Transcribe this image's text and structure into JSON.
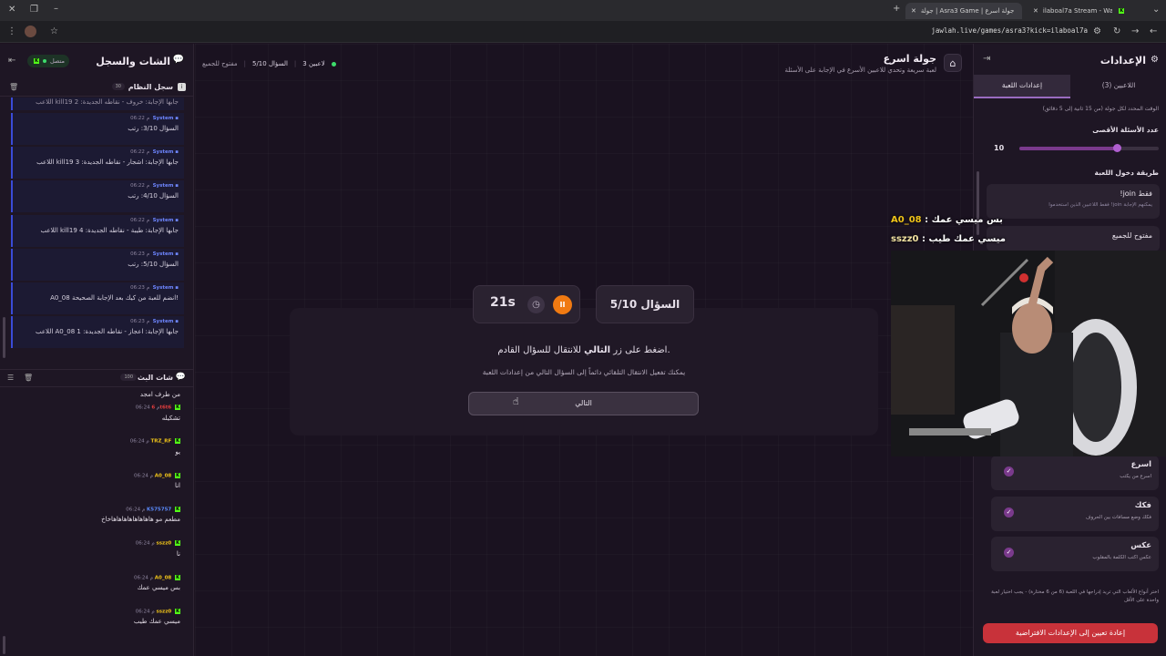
{
  "browser": {
    "tabs": [
      {
        "title": "جولة | Asra3 Game | جولة اسرع",
        "active": true
      },
      {
        "title": "ilaboal7a Stream - Watch Live o",
        "active": false
      }
    ],
    "url": "jawlah.live/games/asra3?kick=ilaboal7a"
  },
  "left_panel": {
    "title": "الشات والسجل",
    "connected_label": "متصل",
    "system_log": {
      "title": "سجل النظام",
      "count": "30",
      "cut_message": "اللاعب kill19 جابها الإجابة: خروف - نقاطه الجديدة: 2",
      "messages": [
        {
          "sender": "System",
          "time": "06:22 م",
          "text": "السؤال 3/10: رتب"
        },
        {
          "sender": "System",
          "time": "06:22 م",
          "text": "اللاعب kill19 جابها الإجابة: اشجار - نقاطه الجديدة: 3"
        },
        {
          "sender": "System",
          "time": "06:22 م",
          "text": "السؤال 4/10: رتب"
        },
        {
          "sender": "System",
          "time": "06:22 م",
          "text": "اللاعب kill19 جابها الإجابة: طيبة - نقاطه الجديدة: 4"
        },
        {
          "sender": "System",
          "time": "06:23 م",
          "text": "السؤال 5/10: رتب"
        },
        {
          "sender": "System",
          "time": "06:23 م",
          "text": "A0_08 انضم للعبة من كيك بعد الإجابة الصحيحة!"
        },
        {
          "sender": "System",
          "time": "06:23 م",
          "text": "اللاعب A0_08 جابها الإجابة: اعجاز - نقاطه الجديدة: 1"
        }
      ]
    },
    "live_chat": {
      "title": "شات البث",
      "count": "100",
      "cut_message": "من طرف امجد",
      "messages": [
        {
          "user": "6t6t6",
          "color": "#e23d3d",
          "time": "06:24 م",
          "text": "تشكيله"
        },
        {
          "user": "TRZ_RF",
          "color": "#f0c419",
          "time": "06:24 م",
          "text": "يو"
        },
        {
          "user": "A0_08",
          "color": "#f0c419",
          "time": "06:24 م",
          "text": "انا"
        },
        {
          "user": "K575757",
          "color": "#5b8cff",
          "time": "06:24 م",
          "text": "مطعم مو هاهاهاهاهاهاهاهاخاخ"
        },
        {
          "user": "sszz0",
          "color": "#f0c419",
          "time": "06:24 م",
          "text": "نا"
        },
        {
          "user": "A0_08",
          "color": "#f0c419",
          "time": "06:24 م",
          "text": "بس ميسي عمك"
        },
        {
          "user": "sszz0",
          "color": "#f0c419",
          "time": "06:24 م",
          "text": "ميسي عمك طيب"
        }
      ]
    }
  },
  "center": {
    "title": "جولة اسرع",
    "subtitle": "لعبة سريعة وتحدي للاعبين الأسرع في الإجابة على الأسئلة",
    "players": "3 لاعبين",
    "question_progress": "السؤال 5/10",
    "mode": "مفتوح للجميع",
    "question_label": "السؤال 5/10",
    "timer": "21s",
    "instruction_pre": "اضغط على زر ",
    "instruction_bold": "التالي",
    "instruction_post": " للانتقال للسؤال القادم.",
    "hint": "يمكنك تفعيل الانتقال التلقائي دائماً إلى السؤال التالي من إعدادات اللعبة",
    "next_button": "التالي"
  },
  "right_panel": {
    "title": "الإعدادات",
    "tabs": [
      "إعدادات اللعبة",
      "اللاعبين (3)"
    ],
    "time_note": "الوقت المحدد لكل جولة (من 15 ثانية إلى 5 دقائق)",
    "max_questions_label": "عدد الأسئلة الأقصى",
    "max_questions_value": "10",
    "max_questions_fraction": 0.7,
    "join_method_label": "طريقة دخول اللعبة",
    "join_options": [
      {
        "title": "!join فقط",
        "desc": "فقط اللاعبين الذين استخدموا !join يمكنهم الإجابة"
      },
      {
        "title": "مفتوح للجميع",
        "desc": ""
      }
    ],
    "game_types": [
      {
        "title": "اسرع",
        "desc": "اسرع من يكتب"
      },
      {
        "title": "فكك",
        "desc": "فكك وضع مسافات بين الحروف"
      },
      {
        "title": "عكس",
        "desc": "عكس اكتب الكلمة بالمقلوب"
      }
    ],
    "types_note": "اختر أنواع الألعاب التي تريد إدراجها في اللعبة (6 من 6 مختارة) - يجب اختيار لعبة واحدة على الأقل",
    "reset_button": "إعادة تعيين إلى الإعدادات الافتراضية"
  },
  "overlay": {
    "chat_lines": [
      {
        "user": "A0_08",
        "text": "بس ميسي عمك"
      },
      {
        "user": "sszz0",
        "text": "ميسي عمك طيب"
      }
    ]
  },
  "colors": {
    "accent": "#7a3a8c",
    "orange": "#f07a12",
    "reset_red": "#c8323a",
    "kick_green": "#53fc18"
  }
}
